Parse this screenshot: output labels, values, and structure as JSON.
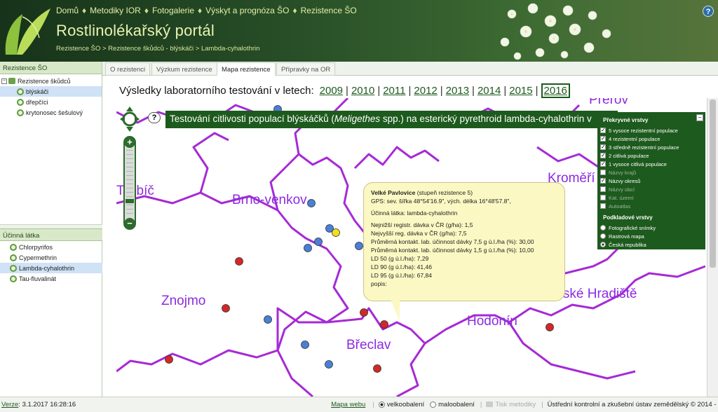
{
  "header": {
    "nav": [
      "Domů",
      "Metodiky IOR",
      "Fotogalerie",
      "Výskyt a prognóza ŠO",
      "Rezistence ŠO"
    ],
    "nav_sep": "♦",
    "title": "Rostlinolékařský portál",
    "breadcrumb": "Rezistence ŠO > Rezistence škůdců - blýskáči > Lambda-cyhalothrin",
    "help_label": "?"
  },
  "left": {
    "panel1_title": "Rezistence ŠO",
    "tree_root": "Rezistence škůdců",
    "tree_items": [
      "blýskáči",
      "dřepčíci",
      "krytonosec šešulový"
    ],
    "panel2_title": "Účinná látka",
    "substances": [
      "Chlorpyrifos",
      "Cypermethrin",
      "Lambda-cyhalothrin",
      "Tau-fluvalinát"
    ]
  },
  "tabs": [
    "O rezistenci",
    "Výzkum rezistence",
    "Mapa rezistence",
    "Přípravky na OR"
  ],
  "results": {
    "title": "Výsledky laboratorního testování v letech:",
    "years": [
      "2009",
      "2010",
      "2011",
      "2012",
      "2013",
      "2014",
      "2015",
      "2016"
    ],
    "selected_year": "2016"
  },
  "map": {
    "banner_pre": "Testování citlivosti populací blýskáčků (",
    "banner_species": "Meligethes",
    "banner_post": " spp.) na esterický pyrethroid lambda-cyhalothrin v",
    "help": "?",
    "zoom_plus": "+",
    "zoom_minus": "−",
    "districts": [
      "Třebíč",
      "Brno-venkov",
      "Kroměří",
      "Znojmo",
      "Břeclav",
      "Hodonín",
      "erské Hradiště",
      "Prerov"
    ],
    "colors": {
      "border": "#a62ad6",
      "red": "#d22828",
      "blue": "#4a7fd8",
      "yellow": "#f0e020"
    }
  },
  "layers": {
    "section1": "Překryvné vrstvy",
    "overlay": [
      {
        "label": "5 vysoce rezistentní populace",
        "checked": true,
        "enabled": true
      },
      {
        "label": "4 rezistentní populace",
        "checked": true,
        "enabled": true
      },
      {
        "label": "3 středně rezistentní populace",
        "checked": true,
        "enabled": true
      },
      {
        "label": "2 citlivá populace",
        "checked": true,
        "enabled": true
      },
      {
        "label": "1 vysoce citlivá populace",
        "checked": true,
        "enabled": true
      },
      {
        "label": "Názvy krajů",
        "checked": false,
        "enabled": false
      },
      {
        "label": "Názvy okresů",
        "checked": true,
        "enabled": true
      },
      {
        "label": "Názvy obcí",
        "checked": false,
        "enabled": false
      },
      {
        "label": "Kat. území",
        "checked": false,
        "enabled": false
      },
      {
        "label": "Autoatlas",
        "checked": false,
        "enabled": false
      }
    ],
    "section2": "Podkladové vrstvy",
    "base": [
      {
        "label": "Fotografické snímky",
        "selected": false
      },
      {
        "label": "Rastrová mapa",
        "selected": false
      },
      {
        "label": "Česká republika",
        "selected": true
      }
    ],
    "minimize": "−"
  },
  "popup": {
    "name": "Velké Pavlovice",
    "level": "(stupeň rezistence 5)",
    "gps": "GPS: sev. šířka 48°54'16.9\", vých. délka 16°48'57.8\",",
    "substance": "Účinná látka: lambda-cyhalothrin",
    "lines": [
      "Nejnižší registr. dávka v ČR (g/ha): 1,5",
      "Nejvyšší reg. dávka v ČR (g/ha): 7,5",
      "Průměrná kontakt. lab. účinnost dávky 7,5 g ú.l./ha (%): 30,00",
      "Průměrná kontakt. lab. účinnost dávky 1,5 g ú.l./ha (%): 10,00",
      "LD 50 (g ú.l./ha): 7,29",
      "LD 90 (g ú.l./ha): 41,46",
      "LD 95 (g ú.l./ha): 67,84",
      "popis:"
    ]
  },
  "status": {
    "version_link": "Verze",
    "datetime": ": 3.1.2017 16:28:16",
    "map_link": "Mapa webu",
    "radio1": "velkoobalení",
    "radio2": "maloobalení",
    "print": "Tisk metodiky",
    "copyright": "Ústřední kontrolní a zkušební ústav zemědělský © 2014 - 2017"
  }
}
